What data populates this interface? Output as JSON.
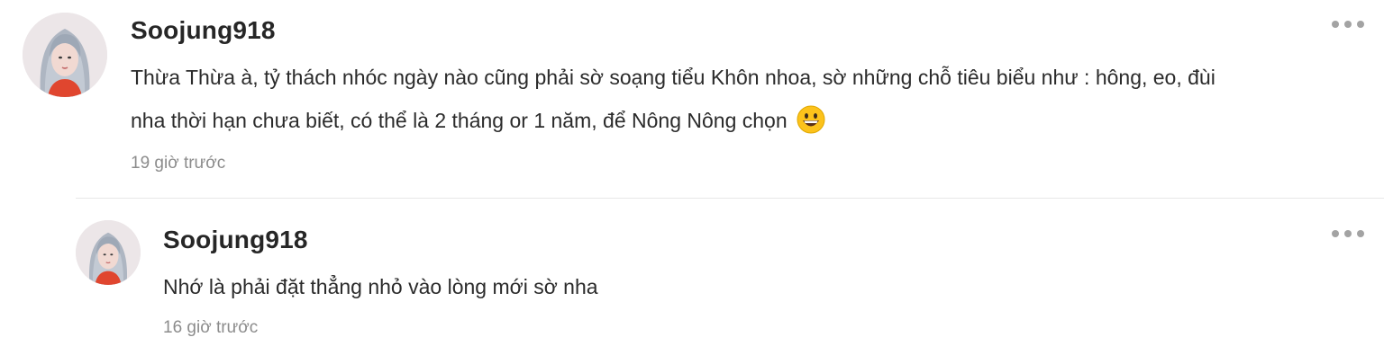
{
  "comments": [
    {
      "username": "Soojung918",
      "text_line1": "Thừa Thừa à, tỷ thách nhóc ngày nào cũng phải sờ soạng tiểu Khôn nhoa, sờ những chỗ tiêu biểu như : hông, eo, đùi",
      "text_line2": "nha thời hạn chưa biết, có thể là 2 tháng or 1 năm, để Nông Nông chọn",
      "emoji": "grinning-face-emoji",
      "timestamp": "19 giờ trước",
      "more_icon": "more-horizontal-icon"
    }
  ],
  "replies": [
    {
      "username": "Soojung918",
      "text_line1": "Nhớ là phải đặt thẳng nhỏ vào lòng mới sờ nha",
      "timestamp": "16 giờ trước",
      "more_icon": "more-horizontal-icon"
    }
  ],
  "colors": {
    "username": "#262626",
    "body": "#2b2b2b",
    "timestamp": "#8c8c8c",
    "dots": "#a3a3a3",
    "divider": "#e8e8e8"
  }
}
